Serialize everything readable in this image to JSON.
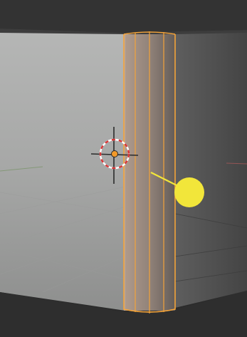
{
  "viewport": {
    "mode": "3d-viewport",
    "background_color": "#2c2c2c"
  },
  "scene": {
    "object_face_left_color": "#a9aaa9",
    "object_face_right_color": "#525252",
    "top_face_color": "#3e3e3e",
    "selection_color": "#f3a33a",
    "light_color": "#f2e63a",
    "cursor_colors": [
      "#d93636",
      "#ffffff"
    ],
    "grid_color": "#5a5a5a"
  },
  "icons": {
    "cursor": "3d-cursor-icon",
    "origin": "object-origin-icon",
    "light": "light-gizmo-icon"
  }
}
